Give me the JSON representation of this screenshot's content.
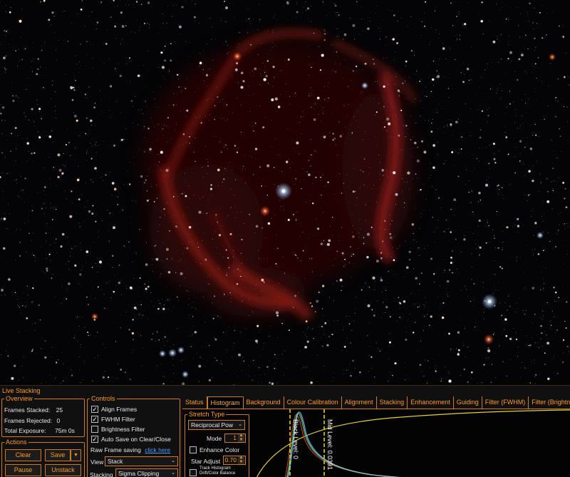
{
  "panel": {
    "title": "Live Stacking"
  },
  "overview": {
    "legend": "Overview",
    "frames_stacked_label": "Frames Stacked:",
    "frames_stacked_value": "25",
    "frames_rejected_label": "Frames Rejected:",
    "frames_rejected_value": "0",
    "total_exposure_label": "Total Exposure:",
    "total_exposure_value": "75m 0s"
  },
  "actions": {
    "legend": "Actions",
    "clear_label": "Clear",
    "save_label": "Save",
    "pause_label": "Pause",
    "unstack_label": "Unstack"
  },
  "controls": {
    "legend": "Controls",
    "align_frames": "Align Frames",
    "fwhm_filter": "FWHM Filter",
    "brightness_filter": "Brightness Filter",
    "auto_save": "Auto Save on Clear/Close",
    "raw_save_label": "Raw Frame saving",
    "raw_save_link": "click here",
    "view_label": "View",
    "view_value": "Stack",
    "stacking_label": "Stacking",
    "stacking_value": "Sigma Clipping"
  },
  "tabs": [
    {
      "label": "Status"
    },
    {
      "label": "Histogram"
    },
    {
      "label": "Background"
    },
    {
      "label": "Colour Calibration"
    },
    {
      "label": "Alignment"
    },
    {
      "label": "Stacking"
    },
    {
      "label": "Enhancement"
    },
    {
      "label": "Guiding"
    },
    {
      "label": "Filter (FWHM)"
    },
    {
      "label": "Filter (Brightness)"
    }
  ],
  "stretch": {
    "legend": "Stretch Type",
    "type_value": "Reciprocal Pow",
    "mode_label": "Mode",
    "mode_value": "1",
    "enhance_color": "Enhance Color",
    "star_adjust_label": "Star Adjust",
    "star_adjust_value": "0.70",
    "track_histogram": "Track Histogram Drift/Color Balance"
  },
  "histogram": {
    "black_level_label": "Black Level: 0",
    "mid_level_label": "Mid Level: 0.0391"
  },
  "colors": {
    "accent": "#ff9b1a",
    "border": "#d07a18",
    "link": "#4a9bff"
  }
}
